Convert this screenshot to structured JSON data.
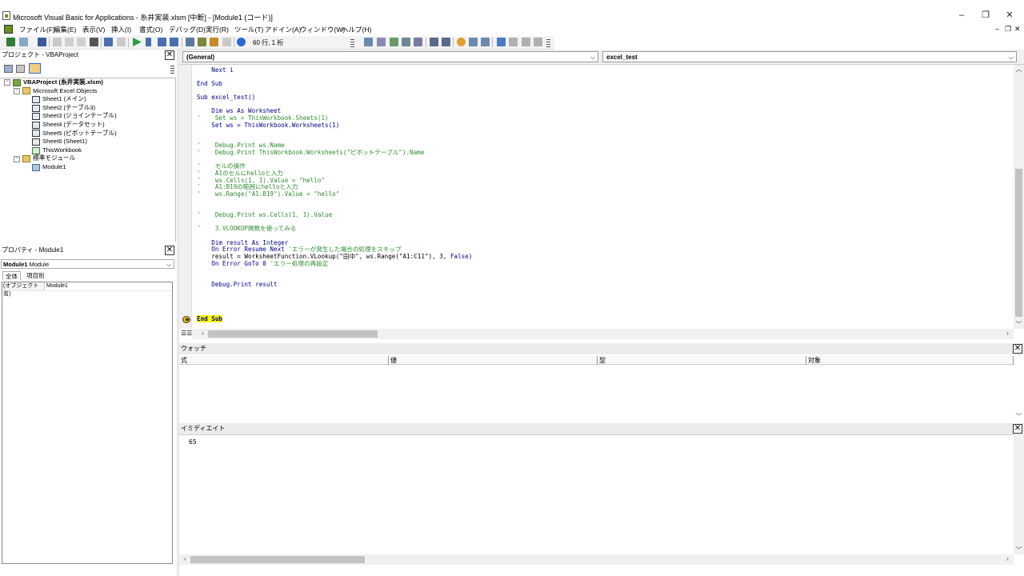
{
  "window": {
    "title": "Microsoft Visual Basic for Applications - 糸井実装.xlsm [中断] - [Module1 (コード)]",
    "minimize": "–",
    "restore": "❐",
    "close": "✕"
  },
  "menu": {
    "items": [
      "ファイル(F)",
      "編集(E)",
      "表示(V)",
      "挿入(I)",
      "書式(O)",
      "デバッグ(D)",
      "実行(R)",
      "ツール(T)",
      "アドイン(A)",
      "ウィンドウ(W)",
      "ヘルプ(H)"
    ],
    "mdi_minimize": "–",
    "mdi_restore": "❐",
    "mdi_close": "✕"
  },
  "toolbar": {
    "position_text": "60 行, 1 桁"
  },
  "project_pane": {
    "title": "プロジェクト - VBAProject",
    "close": "✕",
    "tree": {
      "project": "VBAProject (糸井実装.xlsm)",
      "folder_objects": "Microsoft Excel Objects",
      "sheets": [
        "Sheet1 (メイン)",
        "Sheet2 (テーブル3)",
        "Sheet3 (ジョインテーブル)",
        "Sheet4 (データセット)",
        "Sheet5 (ピボットテーブル)",
        "Sheet6 (Sheet1)"
      ],
      "workbook": "ThisWorkbook",
      "folder_modules": "標準モジュール",
      "module": "Module1"
    }
  },
  "props_pane": {
    "title": "プロパティ - Module1",
    "close": "✕",
    "object_name": "Module1",
    "object_type": "Module",
    "tabs": [
      "全体",
      "項目別"
    ],
    "rows": [
      {
        "name": "(オブジェクト名)",
        "value": "Module1"
      }
    ]
  },
  "code_window": {
    "object_combo": "(General)",
    "proc_combo": "excel_test",
    "lines": [
      {
        "text": "    Next i",
        "kind": "kw"
      },
      {
        "text": "End Sub",
        "kind": "kw"
      },
      {
        "text": "Sub excel_test()",
        "kind": "kw"
      },
      {
        "text": "    Dim ws As Worksheet",
        "kind": "kw"
      },
      {
        "text": "'    Set ws = ThisWorkbook.Sheets(1)",
        "kind": "cm"
      },
      {
        "text": "    Set ws = ThisWorkbook.Worksheets(1)",
        "kind": "kw"
      },
      {
        "text": "'    Debug.Print ws.Name",
        "kind": "cm"
      },
      {
        "text": "'    Debug.Print ThisWorkbook.Worksheets(\"ピボットテーブル\").Name",
        "kind": "cm"
      },
      {
        "text": "'    セルの操作",
        "kind": "cm"
      },
      {
        "text": "'    A1のセルにhelloと入力",
        "kind": "cm"
      },
      {
        "text": "'    ws.Cells(1, 1).Value = \"hello\"",
        "kind": "cm"
      },
      {
        "text": "'    A1:B19の範囲にhelloと入力",
        "kind": "cm"
      },
      {
        "text": "'    ws.Range(\"A1:B19\").Value = \"hello\"",
        "kind": "cm"
      },
      {
        "text": "'    Debug.Print ws.Cells(1, 1).Value",
        "kind": "cm"
      },
      {
        "text": "'    3.VLOOKUP関数を使ってみる",
        "kind": "cm"
      },
      {
        "text": "    Dim result As Integer",
        "kind": "kw"
      },
      {
        "text": "    On Error Resume Next",
        "kind": "kw"
      },
      {
        "text": " 'エラーが発生した場合の処理をスキップ",
        "kind": "cm"
      },
      {
        "text": "    result = WorksheetFunction.VLookup(\"田中\", ws.Range(\"A1:C11\"), 3, ",
        "kind": "tx"
      },
      {
        "text": "False)",
        "kind": "kw"
      },
      {
        "text": "    On Error GoTo 0",
        "kind": "kw"
      },
      {
        "text": " 'エラー処理の再設定",
        "kind": "cm"
      },
      {
        "text": "    Debug.Print result",
        "kind": "kw"
      },
      {
        "text": "End Sub",
        "kind": "hl"
      }
    ]
  },
  "watch_pane": {
    "title": "ウォッチ",
    "close": "✕",
    "columns": [
      "式",
      "値",
      "型",
      "対象"
    ]
  },
  "immediate_pane": {
    "title": "イミディエイト",
    "close": "✕",
    "output": "65"
  }
}
